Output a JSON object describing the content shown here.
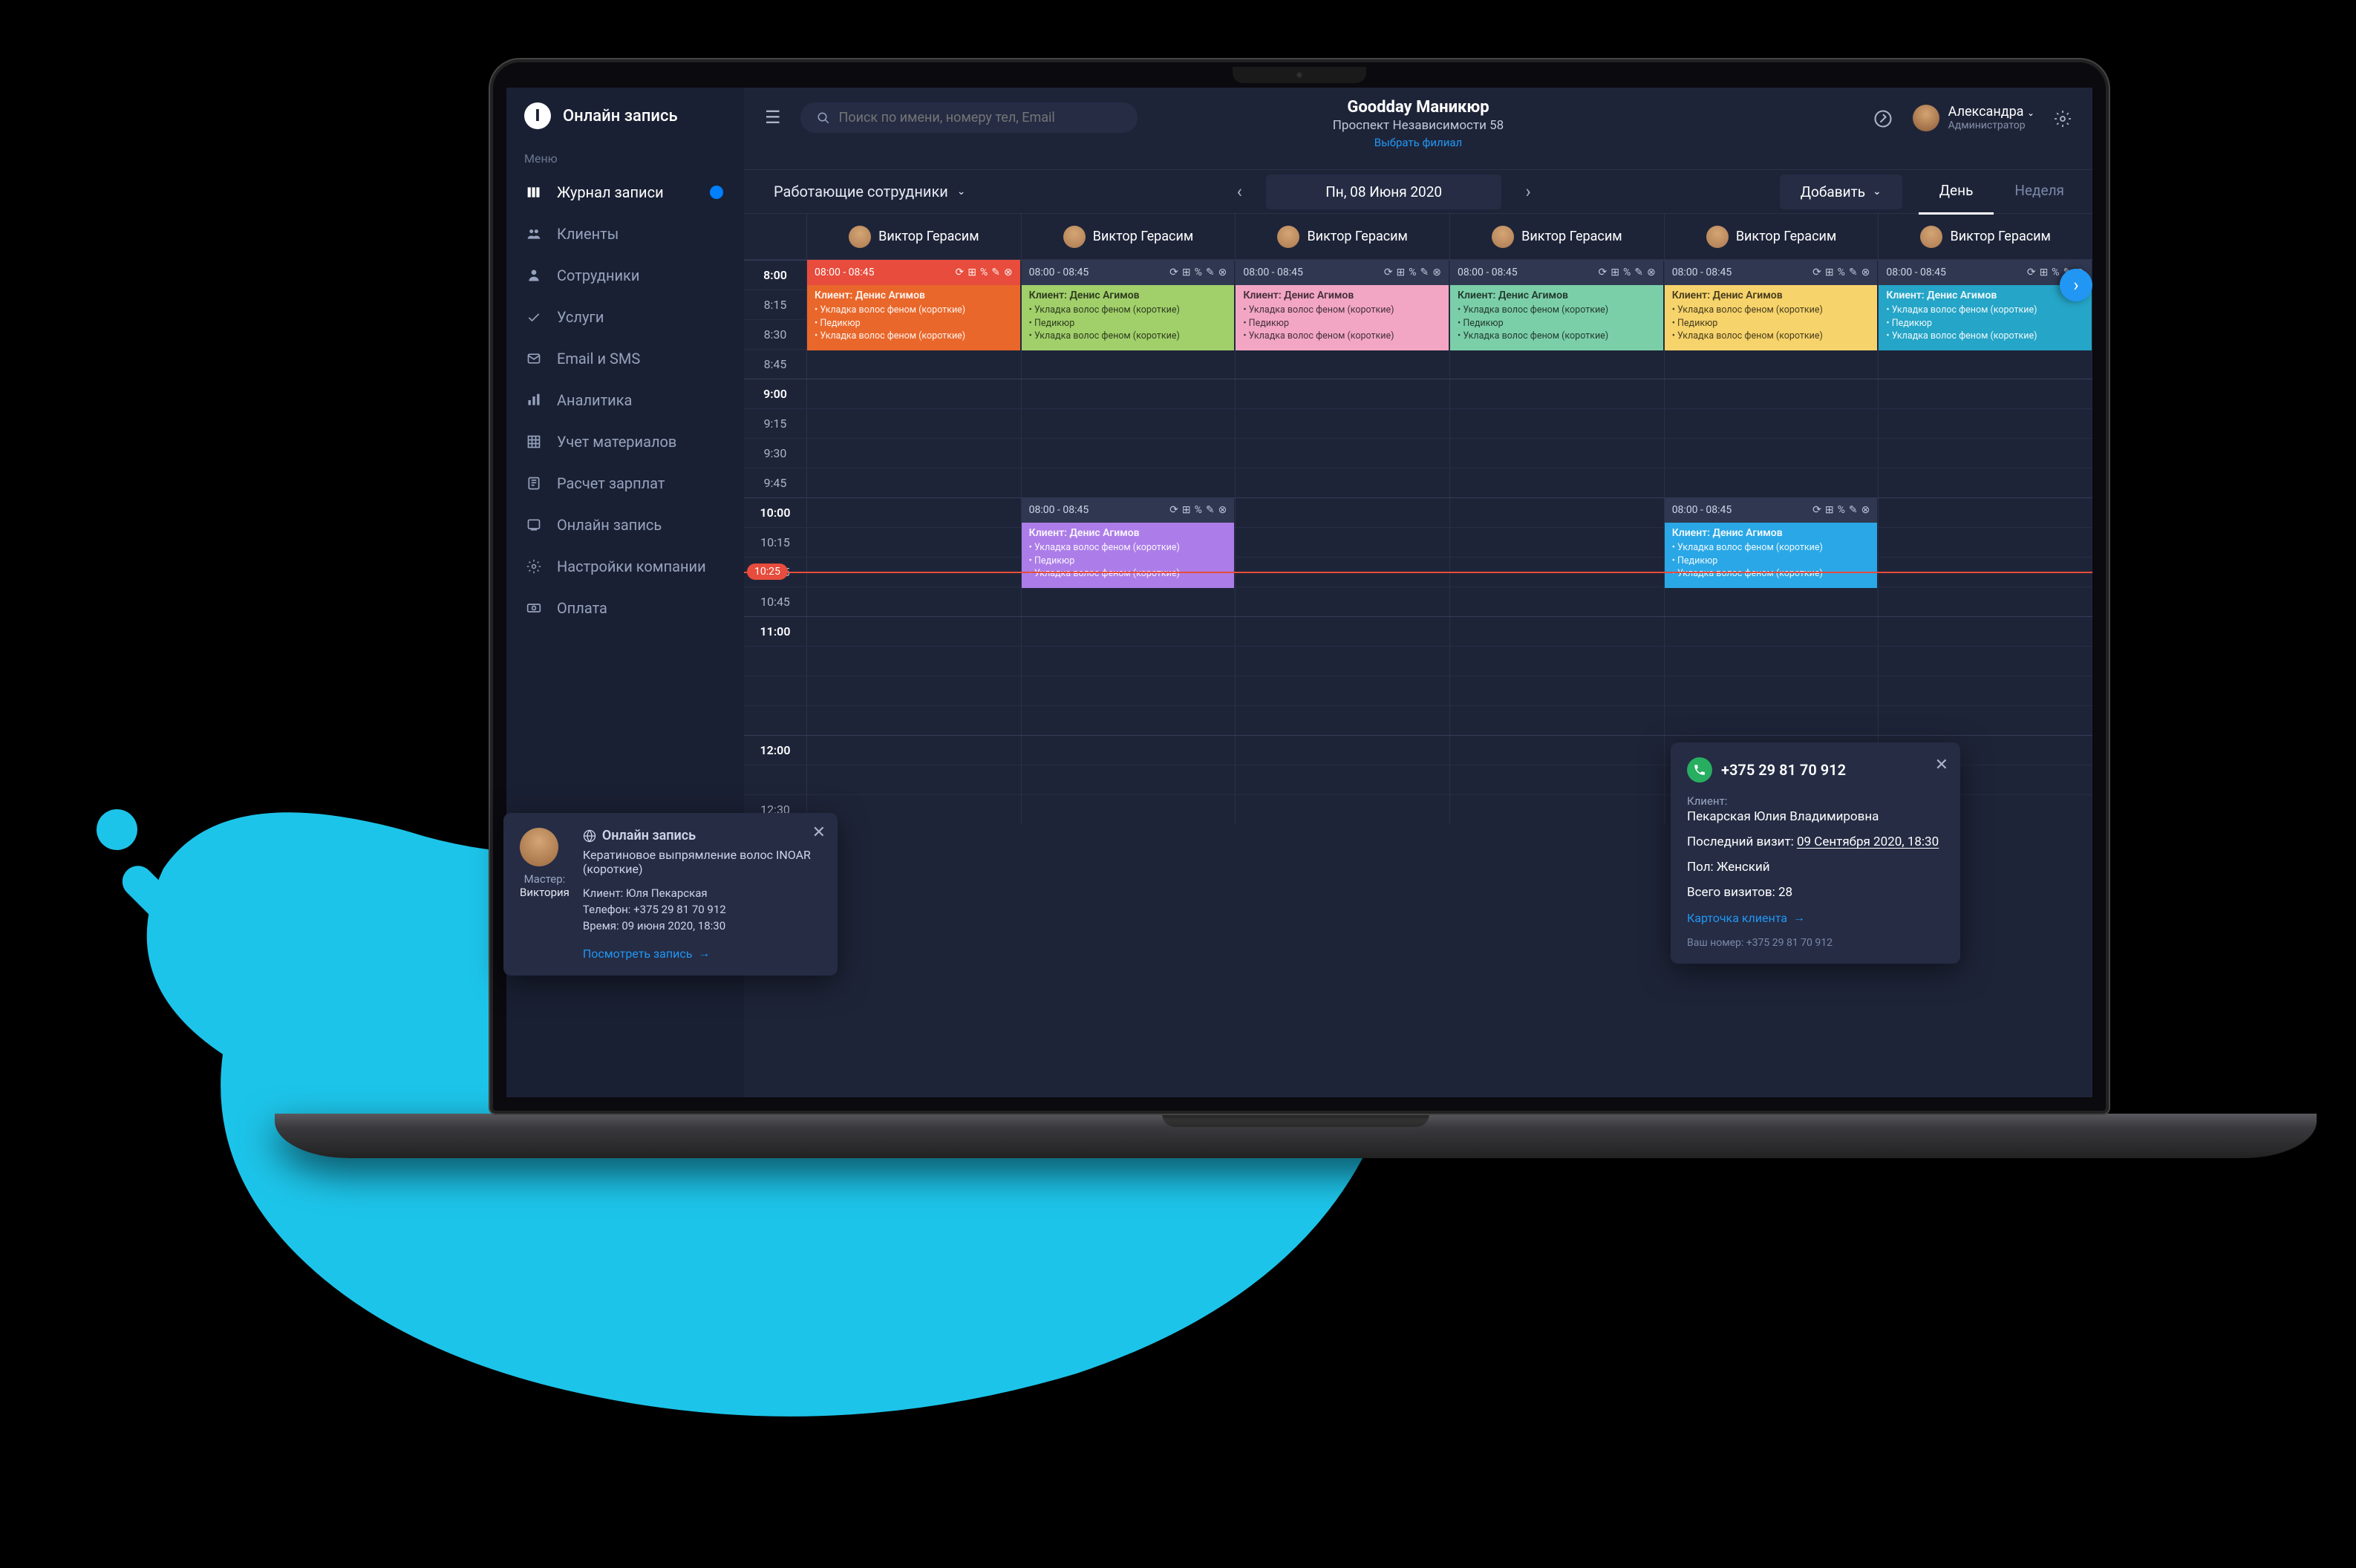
{
  "brand": {
    "label": "Онлайн запись",
    "icon_letter": "I"
  },
  "sidebar": {
    "menu_header": "Меню",
    "items": [
      {
        "label": "Журнал записи",
        "active": true,
        "badge": true
      },
      {
        "label": "Клиенты"
      },
      {
        "label": "Сотрудники"
      },
      {
        "label": "Услуги"
      },
      {
        "label": "Email и SMS"
      },
      {
        "label": "Аналитика"
      },
      {
        "label": "Учет материалов"
      },
      {
        "label": "Расчет зарплат"
      },
      {
        "label": "Онлайн запись"
      },
      {
        "label": "Настройки компании"
      },
      {
        "label": "Оплата"
      }
    ]
  },
  "topbar": {
    "search_placeholder": "Поиск по имени, номеру тел, Email",
    "business_name": "Goodday Маникюр",
    "business_addr": "Проспект Независимости 58",
    "branch_link": "Выбрать филиал",
    "user_name": "Александра",
    "user_role": "Администратор"
  },
  "toolbar": {
    "filter_label": "Работающие сотрудники",
    "date_label": "Пн, 08 Июня 2020",
    "add_label": "Добавить",
    "view_day": "День",
    "view_week": "Неделя"
  },
  "staff_name": "Виктор Герасим",
  "time_slots": [
    "8:00",
    "8:15",
    "8:30",
    "8:45",
    "9:00",
    "9:15",
    "9:30",
    "9:45",
    "10:00",
    "10:15",
    "10:25",
    "10:45",
    "11:00",
    "",
    "",
    "",
    "12:00",
    "",
    "12:30"
  ],
  "now_time": "10:25",
  "appt_header_time": "08:00 - 08:45",
  "appt": {
    "client_label": "Клиент: Денис Агимов",
    "services": [
      "Укладка волос феном (короткие)",
      "Педикюр",
      "Укладка волос феном (короткие)"
    ]
  },
  "colors": {
    "row1": [
      "#e9672a",
      "#a1d06b",
      "#f2a6c4",
      "#7bcfa8",
      "#f6d36b",
      "#25a5c7"
    ],
    "row2": "#ac7de8",
    "row2b": "#2aa7e6"
  },
  "popup1": {
    "title": "Онлайн запись",
    "desc": "Кератиновое выпрямление волос INOAR (короткие)",
    "client": "Клиент: Юля Пекарская",
    "phone": "Телефон: +375 29 81 70 912",
    "time": "Время: 09 июня 2020, 18:30",
    "link": "Посмотреть запись",
    "master_label": "Мастер:",
    "master_name": "Виктория"
  },
  "popup2": {
    "phone": "+375 29 81 70 912",
    "client_label": "Клиент:",
    "client_name": "Пекарская Юлия Владимировна",
    "last_visit_label": "Последний визит:",
    "last_visit": "09 Сентября 2020, 18:30",
    "gender": "Пол: Женский",
    "total_visits": "Всего визитов: 28",
    "card_link": "Карточка клиента",
    "footer": "Ваш номер: +375 29 81 70 912"
  }
}
